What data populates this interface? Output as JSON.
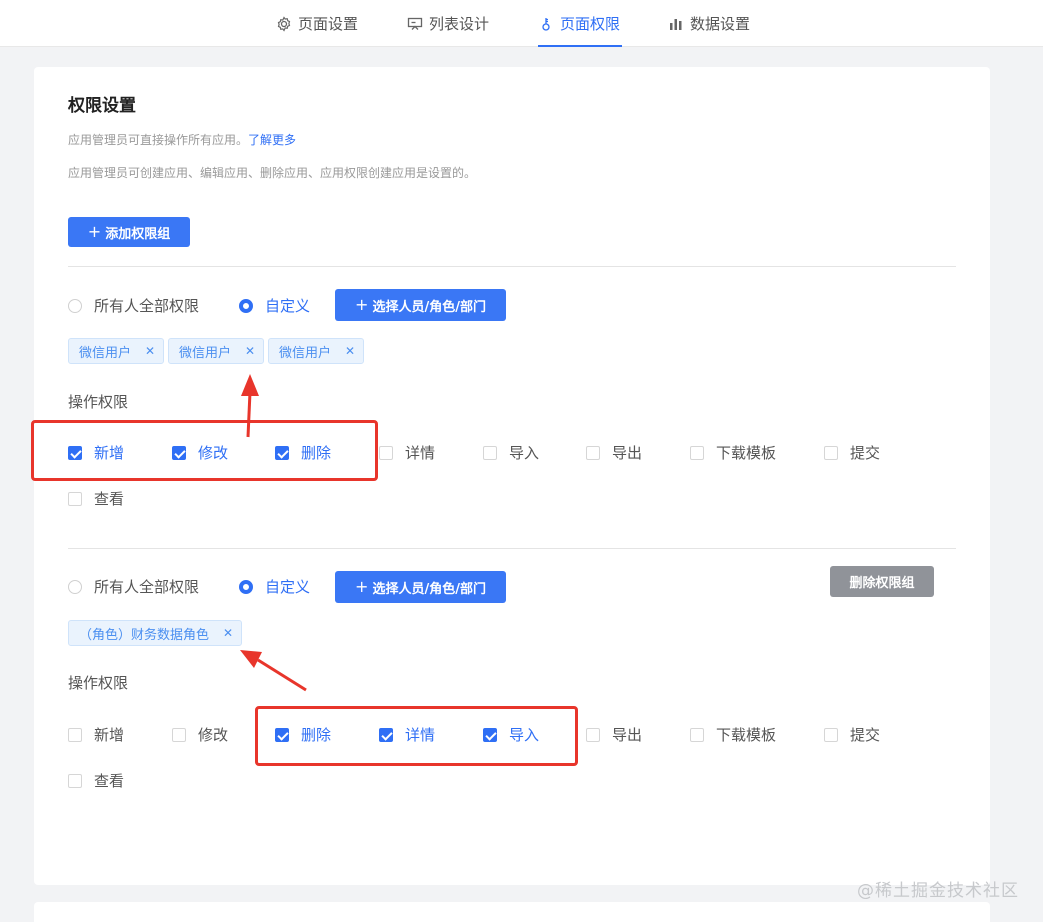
{
  "tabs": [
    {
      "label": "页面设置",
      "icon": "gear-icon"
    },
    {
      "label": "列表设计",
      "icon": "list-design-icon"
    },
    {
      "label": "页面权限",
      "icon": "key-icon",
      "active": true
    },
    {
      "label": "数据设置",
      "icon": "bar-chart-icon"
    }
  ],
  "section": {
    "title": "权限设置",
    "desc1": "应用管理员可直接操作所有应用。",
    "learn_more": "了解更多",
    "desc2": "应用管理员可创建应用、编辑应用、删除应用、应用权限创建应用是设置的。",
    "add_group_label": "添加权限组"
  },
  "groups": [
    {
      "radio_all": "所有人全部权限",
      "radio_custom": "自定义",
      "select_btn": "选择人员/角色/部门",
      "tags": [
        "微信用户",
        "微信用户",
        "微信用户"
      ],
      "ops_label": "操作权限",
      "ops": [
        {
          "label": "新增",
          "checked": true
        },
        {
          "label": "修改",
          "checked": true
        },
        {
          "label": "删除",
          "checked": true
        },
        {
          "label": "详情",
          "checked": false
        },
        {
          "label": "导入",
          "checked": false
        },
        {
          "label": "导出",
          "checked": false
        },
        {
          "label": "下载模板",
          "checked": false
        },
        {
          "label": "提交",
          "checked": false
        },
        {
          "label": "查看",
          "checked": false
        }
      ]
    },
    {
      "radio_all": "所有人全部权限",
      "radio_custom": "自定义",
      "select_btn": "选择人员/角色/部门",
      "delete_btn": "删除权限组",
      "tags": [
        "（角色）财务数据角色"
      ],
      "ops_label": "操作权限",
      "ops": [
        {
          "label": "新增",
          "checked": false
        },
        {
          "label": "修改",
          "checked": false
        },
        {
          "label": "删除",
          "checked": true
        },
        {
          "label": "详情",
          "checked": true
        },
        {
          "label": "导入",
          "checked": true
        },
        {
          "label": "导出",
          "checked": false
        },
        {
          "label": "下载模板",
          "checked": false
        },
        {
          "label": "提交",
          "checked": false
        },
        {
          "label": "查看",
          "checked": false
        }
      ]
    }
  ],
  "watermark": "@稀土掘金技术社区",
  "colors": {
    "accent": "#2f6ff5",
    "annotation": "#e8352b",
    "gray_button": "#909399"
  }
}
